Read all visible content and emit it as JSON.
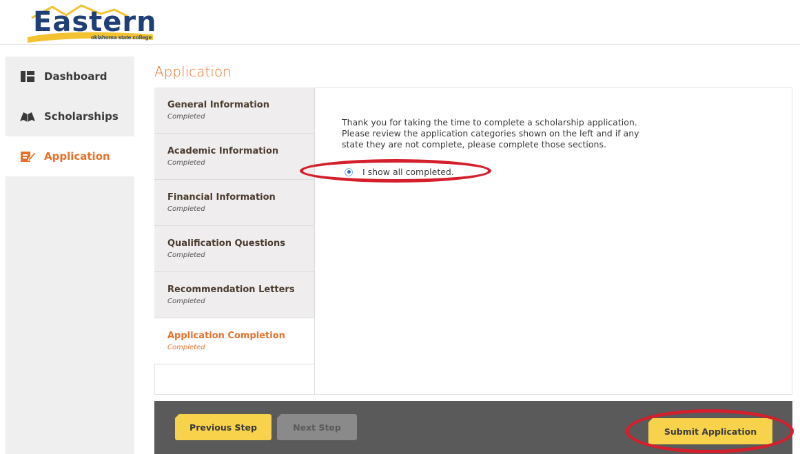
{
  "brand": {
    "logo_text": "Eastern",
    "logo_subtitle": "oklahoma state college",
    "navy": "#1f3f77",
    "gold": "#f2c230",
    "accent_orange": "#e8702a"
  },
  "sidebar": {
    "items": [
      {
        "label": "Dashboard",
        "icon": "dashboard-icon",
        "active": false
      },
      {
        "label": "Scholarships",
        "icon": "book-icon",
        "active": false
      },
      {
        "label": "Application",
        "icon": "edit-icon",
        "active": true
      }
    ]
  },
  "page": {
    "title": "Application"
  },
  "steps": [
    {
      "title": "General Information",
      "status": "Completed",
      "active": false
    },
    {
      "title": "Academic Information",
      "status": "Completed",
      "active": false
    },
    {
      "title": "Financial Information",
      "status": "Completed",
      "active": false
    },
    {
      "title": "Qualification Questions",
      "status": "Completed",
      "active": false
    },
    {
      "title": "Recommendation Letters",
      "status": "Completed",
      "active": false
    },
    {
      "title": "Application Completion",
      "status": "Completed",
      "active": true
    }
  ],
  "completion": {
    "line1": "Thank you for taking the time to complete a scholarship application.",
    "line2": "Please review the application categories shown on the left and if any",
    "line3": "state they are not complete, please complete those sections.",
    "radio_label": "I show all completed.",
    "radio_checked": true
  },
  "footer": {
    "previous_label": "Previous Step",
    "next_label": "Next Step",
    "submit_label": "Submit Application",
    "next_disabled": true
  },
  "annotation_color": "#d41f2c"
}
